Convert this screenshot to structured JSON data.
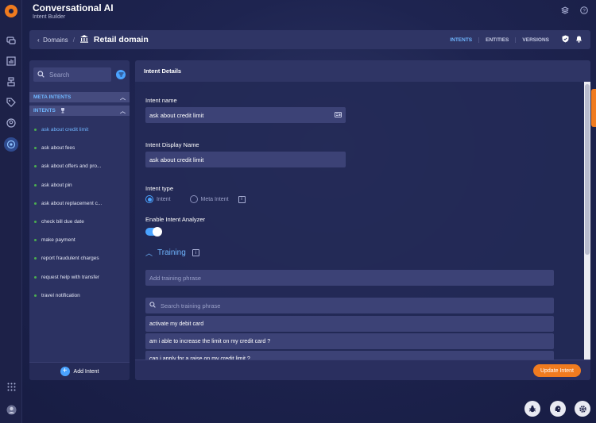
{
  "app": {
    "title": "Conversational AI",
    "subtitle": "Intent Builder"
  },
  "header_icons": [
    "layers-icon",
    "help-icon"
  ],
  "breadcrumb": {
    "back_label": "Domains",
    "title": "Retail domain",
    "title_icon": "bank-icon",
    "tabs": [
      {
        "label": "INTENTS",
        "active": true
      },
      {
        "label": "ENTITIES",
        "active": false
      },
      {
        "label": "VERSIONS",
        "active": false
      }
    ]
  },
  "sidebar": {
    "search_placeholder": "Search",
    "meta_intents_label": "META INTENTS",
    "intents_label": "INTENTS",
    "intents": [
      {
        "label": "ask about credit limit",
        "active": true
      },
      {
        "label": "ask about fees",
        "active": false
      },
      {
        "label": "ask about offers and pro...",
        "active": false
      },
      {
        "label": "ask about pin",
        "active": false
      },
      {
        "label": "ask about replacement c...",
        "active": false
      },
      {
        "label": "check bill due date",
        "active": false
      },
      {
        "label": "make payment",
        "active": false
      },
      {
        "label": "report fraudulent charges",
        "active": false
      },
      {
        "label": "request help with transfer",
        "active": false
      },
      {
        "label": "travel notification",
        "active": false
      }
    ],
    "add_intent_label": "Add Intent"
  },
  "details": {
    "header": "Intent Details",
    "intent_name_label": "Intent name",
    "intent_name_value": "ask about credit limit",
    "display_name_label": "Intent Display Name",
    "display_name_value": "ask about credit limit",
    "intent_type_label": "Intent type",
    "intent_type_options": [
      "Intent",
      "Meta Intent"
    ],
    "intent_type_selected": "Intent",
    "analyzer_label": "Enable Intent Analyzer",
    "analyzer_enabled": true,
    "training_label": "Training",
    "add_phrase_placeholder": "Add training phrase",
    "search_phrase_placeholder": "Search training phrase",
    "phrases": [
      "activate my debit card",
      "am i able to increase the limit on my credit card ?",
      "can i apply for a raise on my credit limit ?"
    ],
    "update_button": "Update Intent"
  },
  "colors": {
    "accent": "#4aa3ff",
    "brand_orange": "#f07b1f",
    "status_dot": "#4caf50"
  }
}
